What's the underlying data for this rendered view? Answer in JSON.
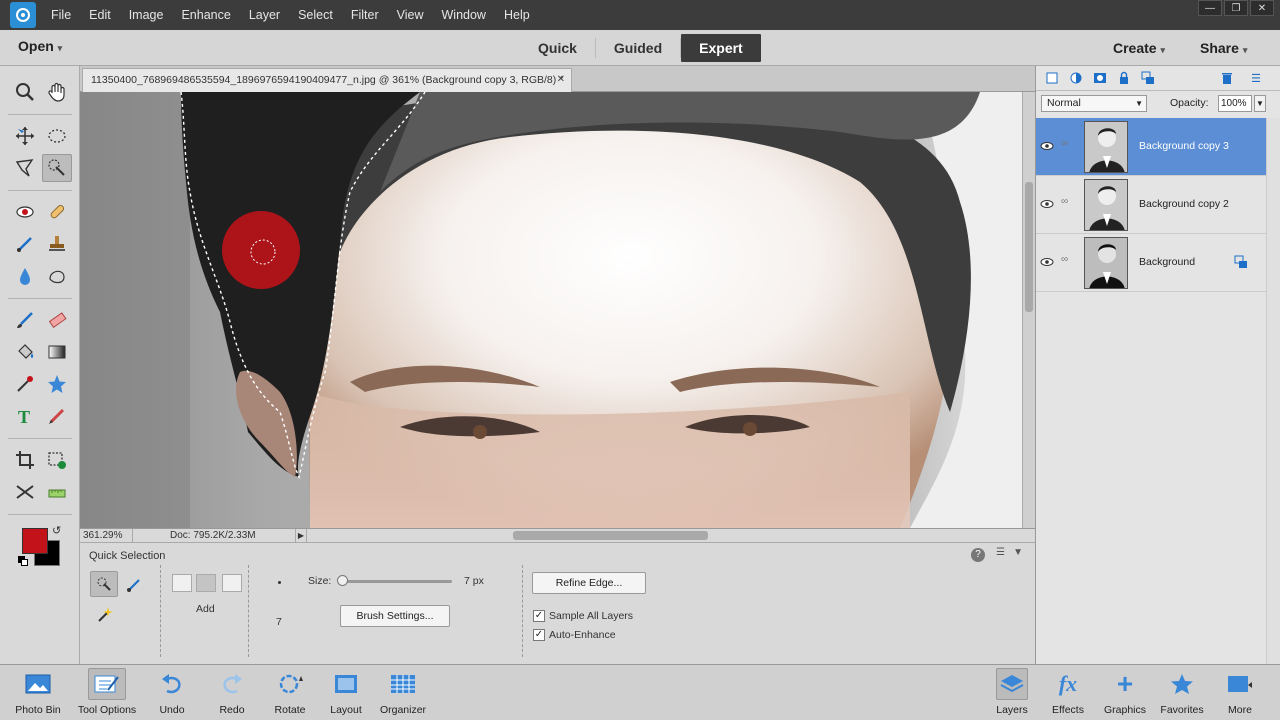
{
  "menubar": {
    "items": [
      "File",
      "Edit",
      "Image",
      "Enhance",
      "Layer",
      "Select",
      "Filter",
      "View",
      "Window",
      "Help"
    ]
  },
  "modebar": {
    "open_label": "Open",
    "tabs": [
      "Quick",
      "Guided",
      "Expert"
    ],
    "active_tab": "Expert",
    "create_label": "Create",
    "share_label": "Share"
  },
  "document": {
    "tab_title": "11350400_768969486535594_1896976594190409477_n.jpg @ 361% (Background copy 3, RGB/8) *",
    "zoom": "361.29%",
    "doc_size": "Doc: 795.2K/2.33M"
  },
  "tool_options": {
    "title": "Quick Selection",
    "mode_label": "Add",
    "size_label": "Size:",
    "size_value": "7 px",
    "size_fraction": 0.0,
    "brush_preview_size": "7",
    "brush_settings_label": "Brush Settings...",
    "refine_edge_label": "Refine Edge...",
    "sample_all_layers_label": "Sample All Layers",
    "sample_all_layers_checked": true,
    "auto_enhance_label": "Auto-Enhance",
    "auto_enhance_checked": true
  },
  "layers_panel": {
    "blend_mode": "Normal",
    "opacity_label": "Opacity:",
    "opacity_value": "100%",
    "layers": [
      {
        "name": "Background copy 3",
        "selected": true
      },
      {
        "name": "Background copy 2",
        "selected": false
      },
      {
        "name": "Background",
        "selected": false
      }
    ]
  },
  "taskbar": {
    "left": [
      {
        "label": "Photo Bin",
        "icon": "photo-bin-icon"
      },
      {
        "label": "Tool Options",
        "icon": "tool-options-icon",
        "active": true
      },
      {
        "label": "Undo",
        "icon": "undo-icon"
      },
      {
        "label": "Redo",
        "icon": "redo-icon"
      },
      {
        "label": "Rotate",
        "icon": "rotate-icon"
      },
      {
        "label": "Layout",
        "icon": "layout-icon"
      },
      {
        "label": "Organizer",
        "icon": "organizer-icon"
      }
    ],
    "right": [
      {
        "label": "Layers",
        "icon": "layers-icon",
        "active": true
      },
      {
        "label": "Effects",
        "icon": "effects-icon"
      },
      {
        "label": "Graphics",
        "icon": "graphics-icon"
      },
      {
        "label": "Favorites",
        "icon": "favorites-icon"
      },
      {
        "label": "More",
        "icon": "more-icon"
      }
    ]
  },
  "colors": {
    "foreground": "#c4121b",
    "background": "#000000",
    "selected_layer": "#5b8ed4",
    "brush_cursor": "#b8141a"
  }
}
